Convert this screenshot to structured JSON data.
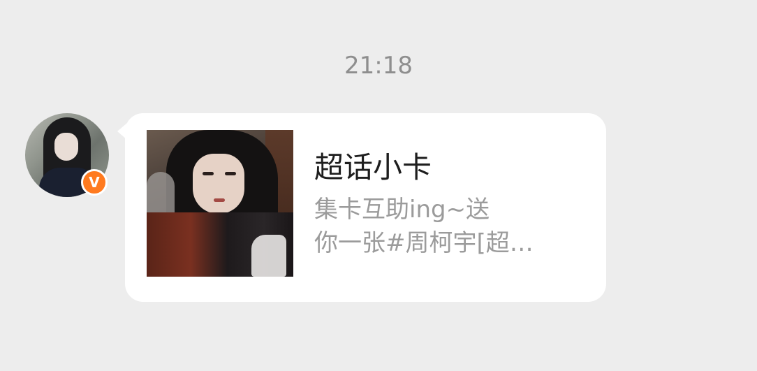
{
  "chat": {
    "timestamp": "21:18"
  },
  "sender": {
    "avatar_icon": "user-avatar",
    "verified_badge": "V",
    "badge_color": "#ff7a1f"
  },
  "card": {
    "title": "超话小卡",
    "description_line1": "集卡互助ing~送",
    "description_line2": "你一张#周柯宇[超…"
  },
  "colors": {
    "background": "#ededed",
    "bubble": "#ffffff",
    "title_text": "#1e1e1e",
    "secondary_text": "#9b9b9b"
  }
}
